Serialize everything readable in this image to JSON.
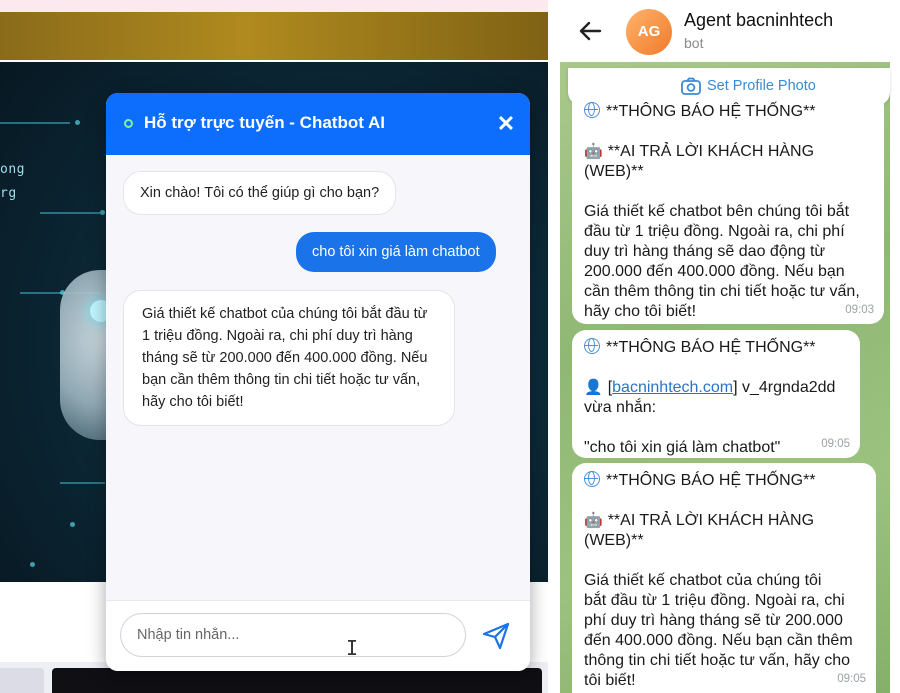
{
  "chat_widget": {
    "title": "Hỗ trợ trực tuyến - Chatbot AI",
    "close_label": "✕",
    "messages": [
      {
        "sender": "bot",
        "text": "Xin chào! Tôi có thể giúp gì cho bạn?"
      },
      {
        "sender": "user",
        "text": "cho tôi xin giá làm chatbot"
      },
      {
        "sender": "bot",
        "text": "Giá thiết kế chatbot của chúng tôi bắt đầu từ 1 triệu đồng. Ngoài ra, chi phí duy trì hàng tháng sẽ từ 200.000 đến 400.000 đồng. Nếu bạn cần thêm thông tin chi tiết hoặc tư vấn, hãy cho tôi biết!"
      }
    ],
    "input_placeholder": "Nhập tin nhắn...",
    "accent_color": "#0d6efd",
    "icons": {
      "send": "send-icon",
      "online": "online-dot-icon",
      "close": "close-icon"
    }
  },
  "website_bg": {
    "hero_text_1": "ong",
    "hero_text_2": "rg"
  },
  "telegram": {
    "avatar_initials": "AG",
    "agent_name": "Agent bacninhtech",
    "agent_status": "bot",
    "set_photo_label": "Set Profile Photo",
    "messages": [
      {
        "line1": "**THÔNG BÁO HỆ THỐNG**",
        "line2": "**AI TRẢ LỜI KHÁCH HÀNG",
        "line3": "(WEB)**",
        "body_lines": [
          "Giá thiết kế chatbot bên chúng tôi bắt",
          "đầu từ 1 triệu đồng. Ngoài ra, chi phí",
          "duy trì hàng tháng sẽ dao động từ",
          "200.000 đến 400.000 đồng. Nếu bạn",
          "cần thêm thông tin chi tiết hoặc tư vấn,",
          "hãy cho tôi biết!"
        ],
        "time": "09:03"
      },
      {
        "line1": "**THÔNG BÁO HỆ THỐNG**",
        "link": "bacninhtech.com",
        "user_rest": "] v_4rgnda2dd",
        "received": "vừa nhắn:",
        "quote": "\"cho tôi xin giá làm chatbot\"",
        "time": "09:05"
      },
      {
        "line1": "**THÔNG BÁO HỆ THỐNG**",
        "line2": "**AI TRẢ LỜI KHÁCH HÀNG",
        "line3": "(WEB)**",
        "body_lines": [
          "Giá thiết kế chatbot của chúng tôi",
          "bắt đầu từ 1 triệu đồng. Ngoài ra, chi",
          "phí duy trì hàng tháng sẽ từ 200.000",
          "đến 400.000 đồng. Nếu bạn cần thêm",
          "thông tin chi tiết hoặc tư vấn, hãy cho",
          "tôi biết!"
        ],
        "time": "09:05"
      }
    ]
  }
}
